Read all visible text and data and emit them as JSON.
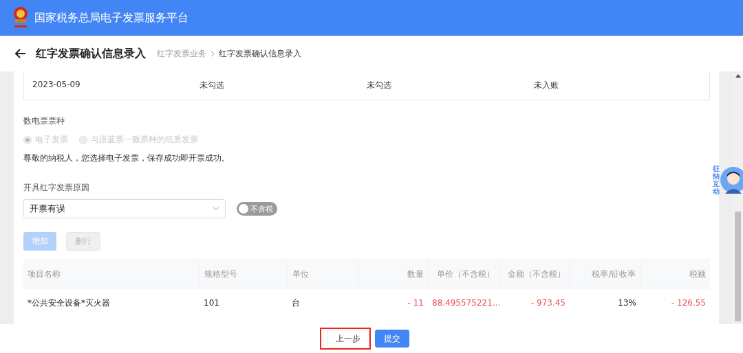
{
  "header": {
    "title": "国家税务总局电子发票服务平台"
  },
  "page": {
    "title": "红字发票确认信息录入",
    "breadcrumb": [
      {
        "label": "红字发票业务",
        "current": false
      },
      {
        "label": "红字发票确认信息录入",
        "current": true
      }
    ]
  },
  "info_card": {
    "values": [
      "2023-05-09",
      "未勾选",
      "未勾选",
      "未入账"
    ]
  },
  "invoice_type": {
    "label": "数电票票种",
    "options": [
      {
        "label": "电子发票",
        "selected": true,
        "disabled": true
      },
      {
        "label": "与原蓝票一致票种的纸质发票",
        "selected": false,
        "disabled": true
      }
    ],
    "notice": "尊敬的纳税人，您选择电子发票，保存成功即开票成功。"
  },
  "reason": {
    "label": "开具红字发票原因",
    "value": "开票有误"
  },
  "tax_toggle": {
    "label": "不含税",
    "on": false
  },
  "table_buttons": [
    {
      "label": "增加",
      "kind": "primary",
      "disabled": true
    },
    {
      "label": "删行",
      "kind": "default",
      "disabled": true
    }
  ],
  "table": {
    "columns": [
      {
        "label": "项目名称"
      },
      {
        "label": "规格型号"
      },
      {
        "label": "单位"
      },
      {
        "label": "数量"
      },
      {
        "label": "单价（不含税）"
      },
      {
        "label": "金额（不含税）"
      },
      {
        "label": "税率/征收率"
      },
      {
        "label": "税额"
      }
    ],
    "rows": [
      {
        "cells": [
          {
            "text": "*公共安全设备*灭火器",
            "negative": false
          },
          {
            "text": "101",
            "negative": false
          },
          {
            "text": "台",
            "negative": false
          },
          {
            "text": "- 11",
            "negative": true
          },
          {
            "text": "88.495575221...",
            "negative": true
          },
          {
            "text": "- 973.45",
            "negative": true
          },
          {
            "text": "13%",
            "negative": false
          },
          {
            "text": "- 126.55",
            "negative": true
          }
        ]
      }
    ]
  },
  "footer": {
    "buttons": [
      {
        "label": "上一步",
        "kind": "default",
        "highlighted": true
      },
      {
        "label": "提交",
        "kind": "primary",
        "highlighted": false
      }
    ]
  },
  "assistant": {
    "label": "征纳互动"
  }
}
